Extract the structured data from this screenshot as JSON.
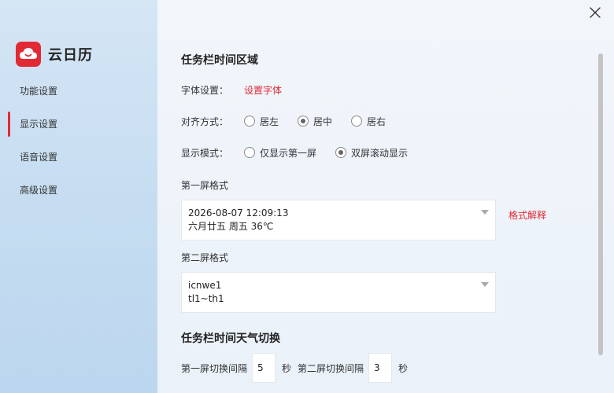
{
  "app": {
    "title": "云日历",
    "logo_icon": "cloud-calendar-icon",
    "brand_color": "#e22a35"
  },
  "sidebar": {
    "items": [
      {
        "label": "功能设置",
        "active": false
      },
      {
        "label": "显示设置",
        "active": true
      },
      {
        "label": "语音设置",
        "active": false
      },
      {
        "label": "高级设置",
        "active": false
      }
    ]
  },
  "taskbar_time": {
    "title": "任务栏时间区域",
    "font": {
      "label": "字体设置：",
      "link": "设置字体"
    },
    "align": {
      "label": "对齐方式：",
      "options": [
        "居左",
        "居中",
        "居右"
      ],
      "selected": "居中"
    },
    "display_mode": {
      "label": "显示模式：",
      "options": [
        "仅显示第一屏",
        "双屏滚动显示"
      ],
      "selected": "双屏滚动显示"
    },
    "first_screen": {
      "label": "第一屏格式",
      "line1": "2026-08-07 12:09:13",
      "line2": "六月廿五 周五 36℃",
      "help_link": "格式解释"
    },
    "second_screen": {
      "label": "第二屏格式",
      "line1": "icnwe1",
      "line2": "tl1~th1"
    }
  },
  "weather_switch": {
    "title": "任务栏时间天气切换",
    "first_label": "第一屏切换间隔",
    "first_value": "5",
    "unit": "秒",
    "second_label": "第二屏切换间隔",
    "second_value": "3"
  }
}
